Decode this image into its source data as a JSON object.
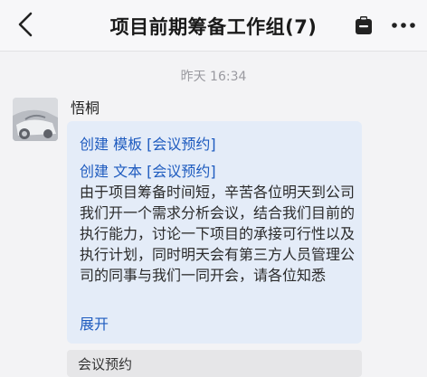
{
  "header": {
    "title": "项目前期筹备工作组(7)",
    "back_icon": "chevron-left-icon",
    "clip_icon": "clipboard-icon",
    "more_icon": "more-dots-icon"
  },
  "timestamp": "昨天 16:34",
  "message": {
    "sender": "悟桐",
    "avatar": "car-photo-avatar",
    "links": [
      "创建 模板 [会议预约]",
      "创建 文本 [会议预约]"
    ],
    "body": "由于项目筹备时间短，辛苦各位明天到公司我们开一个需求分析会议，结合我们目前的执行能力，讨论一下项目的承接可行性以及执行计划，同时明天会有第三方人员管理公司的同事与我们一同开会，请各位知悉",
    "expand_label": "展开"
  },
  "quote": {
    "label": "会议预约"
  },
  "colors": {
    "link": "#1e5bbf",
    "bubble": "#e4ecf8",
    "background": "#f3f3f5"
  }
}
